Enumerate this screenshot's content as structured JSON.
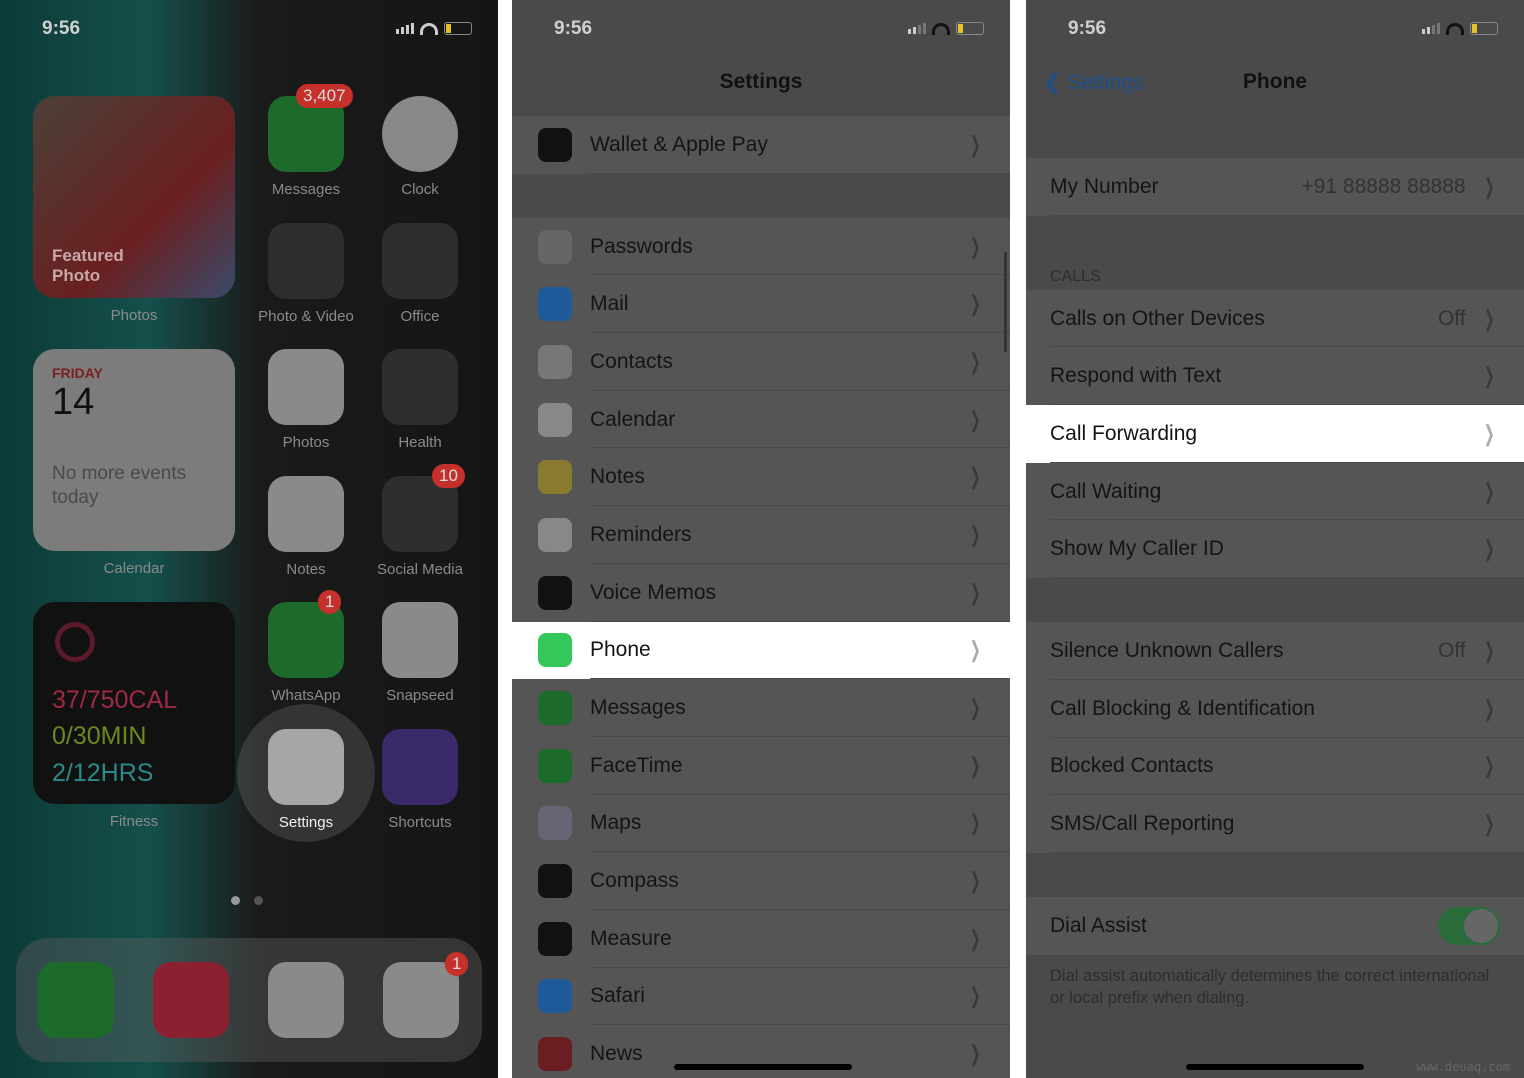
{
  "status": {
    "time": "9:56"
  },
  "home": {
    "photo_widget": {
      "caption": "Featured Photo",
      "label": "Photos"
    },
    "calendar_widget": {
      "day": "FRIDAY",
      "date": "14",
      "text": "No more events today",
      "label": "Calendar"
    },
    "fitness_widget": {
      "cal": "37/750CAL",
      "min": "0/30MIN",
      "hrs": "2/12HRS",
      "label": "Fitness"
    },
    "apps": [
      {
        "label": "Messages",
        "badge": "3,407",
        "color": "#1d6b2a"
      },
      {
        "label": "Clock",
        "badge": "",
        "color": "#888"
      },
      {
        "label": "Photo & Video",
        "badge": "",
        "color": "#2e2e2e"
      },
      {
        "label": "Office",
        "badge": "",
        "color": "#2e2e2e"
      },
      {
        "label": "Photos",
        "badge": "",
        "color": "#8a8a8a"
      },
      {
        "label": "Health",
        "badge": "",
        "color": "#2e2e2e"
      },
      {
        "label": "Notes",
        "badge": "",
        "color": "#8a8a8a"
      },
      {
        "label": "Social Media",
        "badge": "10",
        "color": "#2e2e2e"
      },
      {
        "label": "WhatsApp",
        "badge": "1",
        "color": "#1d6b2a"
      },
      {
        "label": "Snapseed",
        "badge": "",
        "color": "#8a8a8a"
      },
      {
        "label": "Settings",
        "badge": "",
        "color": "#9a9a9a"
      },
      {
        "label": "Shortcuts",
        "badge": "",
        "color": "#3a2a6a"
      }
    ],
    "dock": [
      {
        "name": "phone",
        "color": "#1d6b2a",
        "badge": ""
      },
      {
        "name": "music",
        "color": "#8a2030",
        "badge": ""
      },
      {
        "name": "chrome",
        "color": "#8a8a8a",
        "badge": ""
      },
      {
        "name": "slack",
        "color": "#8a8a8a",
        "badge": "1"
      }
    ]
  },
  "settings": {
    "title": "Settings",
    "groups": [
      [
        {
          "label": "Wallet & Apple Pay",
          "icon": "wallet-icon",
          "color": "#111"
        }
      ],
      [
        {
          "label": "Passwords",
          "icon": "key-icon",
          "color": "#666"
        },
        {
          "label": "Mail",
          "icon": "mail-icon",
          "color": "#1e5a9a"
        },
        {
          "label": "Contacts",
          "icon": "contacts-icon",
          "color": "#777"
        },
        {
          "label": "Calendar",
          "icon": "calendar-icon",
          "color": "#888"
        },
        {
          "label": "Notes",
          "icon": "notes-icon",
          "color": "#8a7a30"
        },
        {
          "label": "Reminders",
          "icon": "reminders-icon",
          "color": "#888"
        },
        {
          "label": "Voice Memos",
          "icon": "voice-memos-icon",
          "color": "#111"
        },
        {
          "label": "Phone",
          "icon": "phone-icon",
          "color": "#34c759",
          "highlight": true
        },
        {
          "label": "Messages",
          "icon": "messages-icon",
          "color": "#1d6b2a"
        },
        {
          "label": "FaceTime",
          "icon": "facetime-icon",
          "color": "#1d6b2a"
        },
        {
          "label": "Maps",
          "icon": "maps-icon",
          "color": "#667"
        },
        {
          "label": "Compass",
          "icon": "compass-icon",
          "color": "#111"
        },
        {
          "label": "Measure",
          "icon": "measure-icon",
          "color": "#111"
        },
        {
          "label": "Safari",
          "icon": "safari-icon",
          "color": "#1e5a9a"
        },
        {
          "label": "News",
          "icon": "news-icon",
          "color": "#6a1e22"
        }
      ]
    ]
  },
  "phone": {
    "back": "Settings",
    "title": "Phone",
    "my_number": {
      "label": "My Number",
      "value": "+91 88888 88888"
    },
    "calls_header": "CALLS",
    "calls": [
      {
        "label": "Calls on Other Devices",
        "value": "Off"
      },
      {
        "label": "Respond with Text",
        "value": ""
      },
      {
        "label": "Call Forwarding",
        "value": "",
        "highlight": true
      },
      {
        "label": "Call Waiting",
        "value": ""
      },
      {
        "label": "Show My Caller ID",
        "value": ""
      }
    ],
    "blocking": [
      {
        "label": "Silence Unknown Callers",
        "value": "Off"
      },
      {
        "label": "Call Blocking & Identification",
        "value": ""
      },
      {
        "label": "Blocked Contacts",
        "value": ""
      },
      {
        "label": "SMS/Call Reporting",
        "value": ""
      }
    ],
    "dial_assist": {
      "label": "Dial Assist",
      "on": true,
      "footer": "Dial assist automatically determines the correct international or local prefix when dialing."
    }
  },
  "watermark": "www.deuaq.com"
}
